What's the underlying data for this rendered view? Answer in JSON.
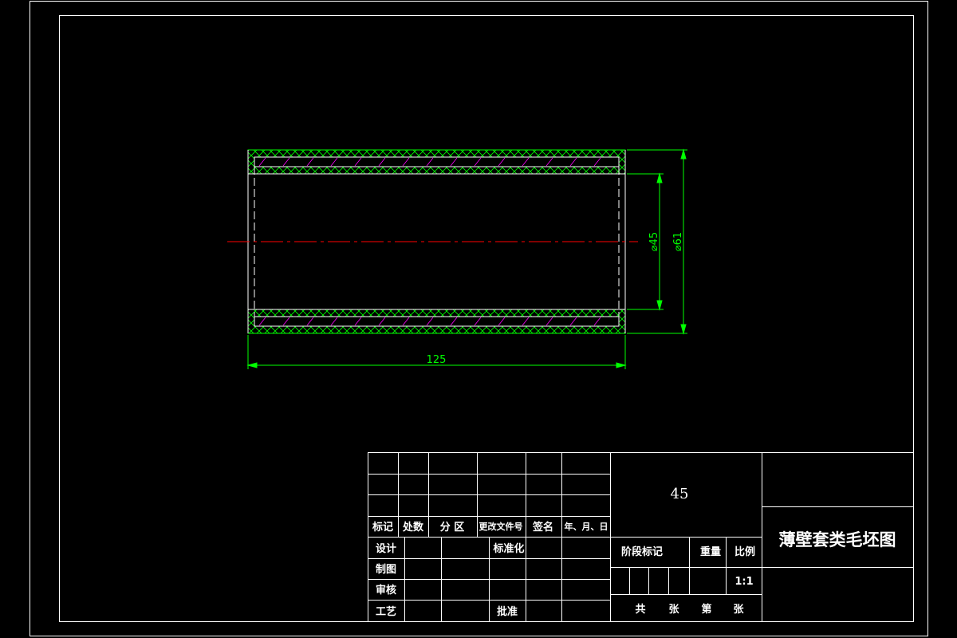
{
  "drawing": {
    "dimensions": {
      "length": "125",
      "inner_diameter": "⌀45",
      "outer_diameter": "⌀61"
    },
    "colors": {
      "background": "#000000",
      "frame": "#ffffff",
      "outline": "#ffffff",
      "hatch": "#00ff00",
      "hatch_secondary": "#ff00ff",
      "dimension": "#00ff00",
      "centerline": "#ff0000"
    }
  },
  "title_block": {
    "material": "45",
    "title": "薄壁套类毛坯图",
    "revision_headers": {
      "mark": "标记",
      "count": "处数",
      "zone": "分 区",
      "change_doc": "更改文件号",
      "signature": "签名",
      "date": "年、月、日"
    },
    "roles": {
      "design": "设计",
      "standardization": "标准化",
      "drawing": "制图",
      "review": "审核",
      "process": "工艺",
      "approval": "批准"
    },
    "stage_mark": "阶段标记",
    "weight": "重量",
    "scale_label": "比例",
    "scale_value": "1:1",
    "sheets_total_prefix": "共",
    "sheets_unit_1": "张",
    "sheet_no_prefix": "第",
    "sheets_unit_2": "张"
  }
}
